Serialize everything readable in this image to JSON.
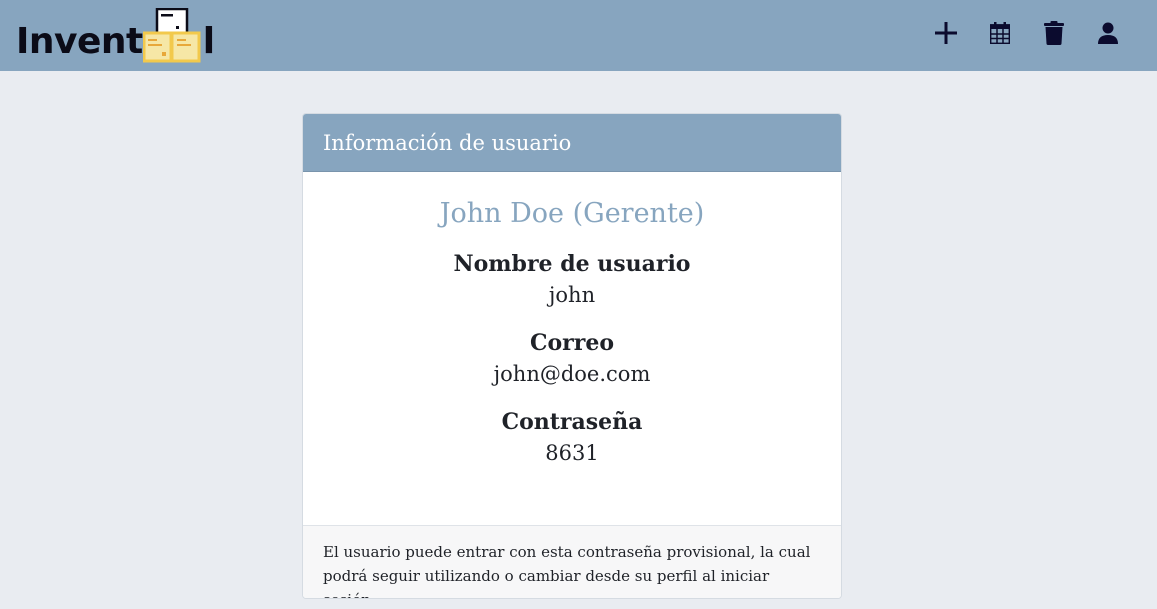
{
  "app": {
    "brand_text_start": "Invent",
    "brand_text_end": "l",
    "logo_name": "inventool-logo"
  },
  "nav": {
    "icons": [
      {
        "name": "plus-icon"
      },
      {
        "name": "calendar-icon"
      },
      {
        "name": "trash-icon"
      },
      {
        "name": "user-icon"
      }
    ]
  },
  "card": {
    "header_title": "Información de usuario",
    "user_display": "John Doe (Gerente)",
    "fields": [
      {
        "label": "Nombre de usuario",
        "value": "john"
      },
      {
        "label": "Correo",
        "value": "john@doe.com"
      },
      {
        "label": "Contraseña",
        "value": "8631"
      }
    ],
    "footer_line1": "El usuario puede entrar con esta contraseña provisional, la cual",
    "footer_line2": "podrá seguir utilizando o cambiar desde su perfil al iniciar sesión"
  },
  "colors": {
    "navbar": "#87a5bf",
    "page_background": "#e9ecf1",
    "accent_text": "#87a5bf",
    "icon": "#0b0b2e",
    "logo_yellow": "#f2c94c"
  }
}
